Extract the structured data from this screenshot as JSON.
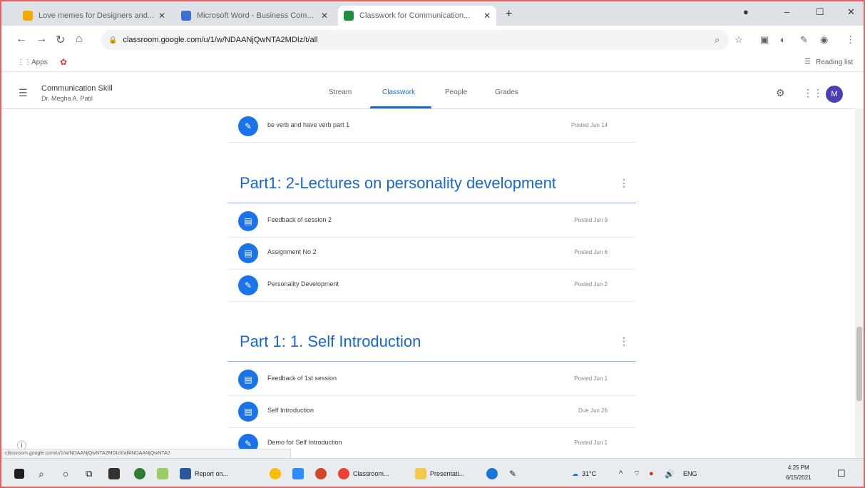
{
  "browser": {
    "tabs": [
      {
        "title": "Love memes for Designers and...",
        "favicon_color": "#f2a900",
        "active": false
      },
      {
        "title": "Microsoft Word - Business Com...",
        "favicon_color": "#3b6fd4",
        "active": false
      },
      {
        "title": "Classwork for Communication...",
        "favicon_color": "#1e8e3e",
        "active": true
      }
    ],
    "new_tab": "+",
    "window_controls": {
      "minimize": "–",
      "maximize": "☐",
      "close": "✕"
    },
    "url": "classroom.google.com/u/1/w/NDAANjQwNTA2MDIz/t/all",
    "bookmarks": {
      "apps_label": "Apps",
      "reading_list": "Reading list"
    }
  },
  "classroom": {
    "class_name": "Communication Skill",
    "teacher": "Dr. Megha A. Patil",
    "nav": {
      "stream": "Stream",
      "classwork": "Classwork",
      "people": "People",
      "grades": "Grades"
    },
    "avatar_letter": "M",
    "items_top": [
      {
        "title": "be verb and have verb part 1",
        "date": "Posted Jun 14",
        "icon": "assignment-icon"
      }
    ],
    "topics": [
      {
        "title": "Part1: 2-Lectures on personality development",
        "items": [
          {
            "title": "Feedback of session 2",
            "date": "Posted Jun 9",
            "icon": "material-icon"
          },
          {
            "title": "Assignment No 2",
            "date": "Posted Jun 6",
            "icon": "material-icon"
          },
          {
            "title": "Personality Development",
            "date": "Posted Jun 2",
            "icon": "assignment-icon"
          }
        ]
      },
      {
        "title": "Part 1: 1. Self Introduction",
        "items": [
          {
            "title": "Feedback of 1st session",
            "date": "Posted Jun 1",
            "icon": "material-icon"
          },
          {
            "title": "Self Introduction",
            "date": "Due Jun 26",
            "icon": "material-icon"
          },
          {
            "title": "Demo for Self Introduction",
            "date": "Posted Jun 1",
            "icon": "assignment-icon"
          }
        ]
      }
    ],
    "status_url": "classroom.google.com/u/1/w/NDAANjQwNTA2MDIz/t/all#NDAANjQwNTA2"
  },
  "taskbar": {
    "items": [
      {
        "label": "Report on...",
        "color": "#2b579a"
      },
      {
        "label": "Classroom...",
        "color": "#ea4335"
      },
      {
        "label": "Presentati...",
        "color": "#f2c94c"
      }
    ],
    "temperature": "31°C",
    "language": "ENG",
    "time": "4:25 PM",
    "date": "6/15/2021"
  }
}
